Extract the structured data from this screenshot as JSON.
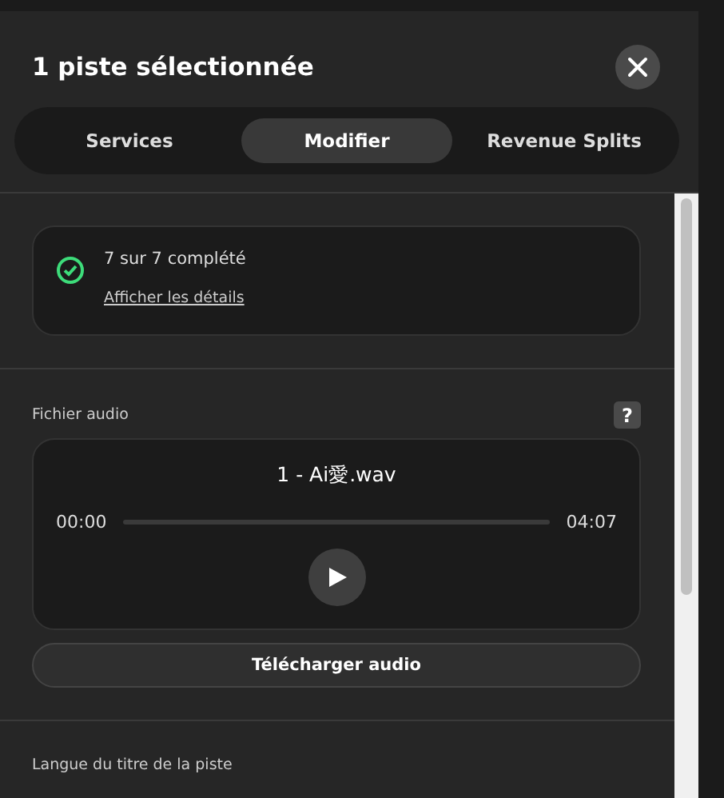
{
  "header": {
    "title": "1 piste sélectionnée"
  },
  "tabs": [
    {
      "label": "Services",
      "selected": false
    },
    {
      "label": "Modifier",
      "selected": true
    },
    {
      "label": "Revenue Splits",
      "selected": false
    }
  ],
  "status": {
    "complete": true,
    "text": "7 sur 7 complété",
    "link": "Afficher les détails"
  },
  "audio": {
    "label": "Fichier audio",
    "help": "?",
    "filename": "1 - Ai愛.wav",
    "elapsed": "00:00",
    "duration": "04:07",
    "level": 0,
    "download": "Télécharger audio"
  },
  "next_field": {
    "label": "Langue du titre de la piste"
  }
}
